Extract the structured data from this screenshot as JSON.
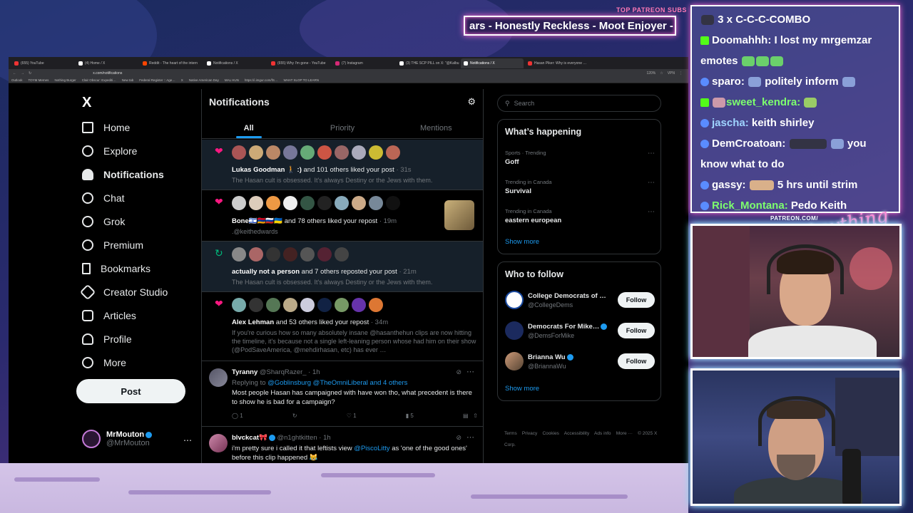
{
  "overlay": {
    "patreon_top": "TOP PATREON SUBS",
    "marquee": "ars - Honestly Reckless - Moot Enjoyer - I",
    "patreon_mid": "PATREON.COM/",
    "signature": "Anything Else"
  },
  "browser": {
    "tabs": [
      {
        "label": "(655) YouTube"
      },
      {
        "label": "(4) Home / X"
      },
      {
        "label": "Reddit - The heart of the intern"
      },
      {
        "label": "Notifications / X"
      },
      {
        "label": "(655) Why I'm gone - YouTube"
      },
      {
        "label": "(7) Instagram"
      },
      {
        "label": "(3) THE SCP PILL on X: \"@Kalbu"
      },
      {
        "label": "Notifications / X"
      },
      {
        "label": "Hasan Piker: Why is everyone …"
      }
    ],
    "url": "x.com/notifications",
    "zoom": "120%",
    "vpn": "VPN",
    "bookmarks": [
      "Outlook",
      "TOYM Memes",
      "Nothing Burger",
      "Clair Obscur: Expediti…",
      "New tab",
      "Federal Register :: Age…",
      "X",
      "Native American Day",
      "MAL HUN",
      "https://i.imgur.com/fS…",
      "WHAT SLOP TO LEARN"
    ]
  },
  "nav": {
    "logo": "X",
    "items": [
      {
        "label": "Home",
        "icon": "home-icon"
      },
      {
        "label": "Explore",
        "icon": "search-icon"
      },
      {
        "label": "Notifications",
        "icon": "bell-icon"
      },
      {
        "label": "Chat",
        "icon": "chat-icon"
      },
      {
        "label": "Grok",
        "icon": "grok-icon"
      },
      {
        "label": "Premium",
        "icon": "premium-icon"
      },
      {
        "label": "Bookmarks",
        "icon": "bookmark-icon"
      },
      {
        "label": "Creator Studio",
        "icon": "rocket-icon"
      },
      {
        "label": "Articles",
        "icon": "articles-icon"
      },
      {
        "label": "Profile",
        "icon": "person-icon"
      },
      {
        "label": "More",
        "icon": "more-icon"
      }
    ],
    "post_label": "Post",
    "account": {
      "name": "MrMouton",
      "handle": "@MrMouton"
    }
  },
  "main": {
    "title": "Notifications",
    "tabs": [
      {
        "label": "All"
      },
      {
        "label": "Priority"
      },
      {
        "label": "Mentions"
      }
    ],
    "notifications": [
      {
        "actor": "Lukas Goodman",
        "extra": "🚶 :)",
        "action": "and 101 others liked your post",
        "time": "· 31s",
        "snippet": "The Hasan cult is obsessed. It's always Destiny or the Jews with them.",
        "type": "like"
      },
      {
        "actor": "Bone",
        "extra": "🇮🇱🇦🇲🇷🇺🇺🇦",
        "action": "and 78 others liked your repost",
        "time": "· 19m",
        "snippet": ".@keithedwards",
        "type": "like"
      },
      {
        "actor": "actually not a person",
        "extra": "",
        "action": "and 7 others reposted your post",
        "time": "· 21m",
        "snippet": "The Hasan cult is obsessed. It's always Destiny or the Jews with them.",
        "type": "repost"
      },
      {
        "actor": "Alex Lehman",
        "extra": "",
        "action": "and 53 others liked your repost",
        "time": "· 34m",
        "snippet": "If you're curious how so many absolutely insane @hasanthehun clips are now hitting the timeline, it's because not a single left-leaning person whose had him on their show (@PodSaveAmerica, @mehdirhasan, etc) has ever …",
        "type": "like"
      }
    ],
    "posts": [
      {
        "name": "Tyranny",
        "handle": "@SharqRazer_",
        "time": "· 1h",
        "reply_prefix": "Replying to",
        "reply_to": "@Goblinsburg @TheOmniLiberal and 4 others",
        "text": "Most people Hasan has campaigned with have won tho, what precedent is there to show he is bad for a campaign?",
        "replies": "1",
        "reposts": "",
        "likes": "1",
        "views": "5"
      },
      {
        "name": "blvckcat🎀",
        "handle": "@n1ghtkitten",
        "time": "· 1h",
        "text_pre": "i'm pretty sure i called it that leftists view",
        "mention": "@PiscoLitty",
        "text_post": "as 'one of the good ones' before this clip happened 😹"
      }
    ]
  },
  "sidebar": {
    "search_placeholder": "Search",
    "happening_title": "What’s happening",
    "trends": [
      {
        "meta": "Sports · Trending",
        "topic": "Goff"
      },
      {
        "meta": "Trending in Canada",
        "topic": "Survival"
      },
      {
        "meta": "Trending in Canada",
        "topic": "eastern european"
      }
    ],
    "show_more": "Show more",
    "who_title": "Who to follow",
    "follow": [
      {
        "name": "College Democrats of …",
        "handle": "@CollegeDems",
        "btn": "Follow"
      },
      {
        "name": "Democrats For Mike…",
        "handle": "@DemsForMike",
        "btn": "Follow"
      },
      {
        "name": "Brianna Wu",
        "handle": "@BriannaWu",
        "btn": "Follow"
      }
    ],
    "footer": "Terms    Privacy    Cookies    Accessibility    Ads info    More ···    © 2025 X Corp."
  },
  "chat": [
    {
      "user": "",
      "text": "3 x C-C-C-COMBO"
    },
    {
      "user": "Doomahhh:",
      "text": "I lost my mrgemzar emotes"
    },
    {
      "user": "sparo:",
      "text": "politely inform"
    },
    {
      "user": "sweet_kendra:",
      "text": ""
    },
    {
      "user": "jascha:",
      "text": "keith shirley"
    },
    {
      "user": "DemCroatoan:",
      "text": "you know what to do"
    },
    {
      "user": "gassy:",
      "text": "5 hrs until strim"
    },
    {
      "user": "Rick_Montana:",
      "text": "Pedo Keith"
    }
  ],
  "colors": {
    "accent": "#1d9bf0",
    "like": "#f91880",
    "repost": "#00ba7c",
    "bg": "#000000",
    "neon_pink": "#ff6ad5"
  }
}
